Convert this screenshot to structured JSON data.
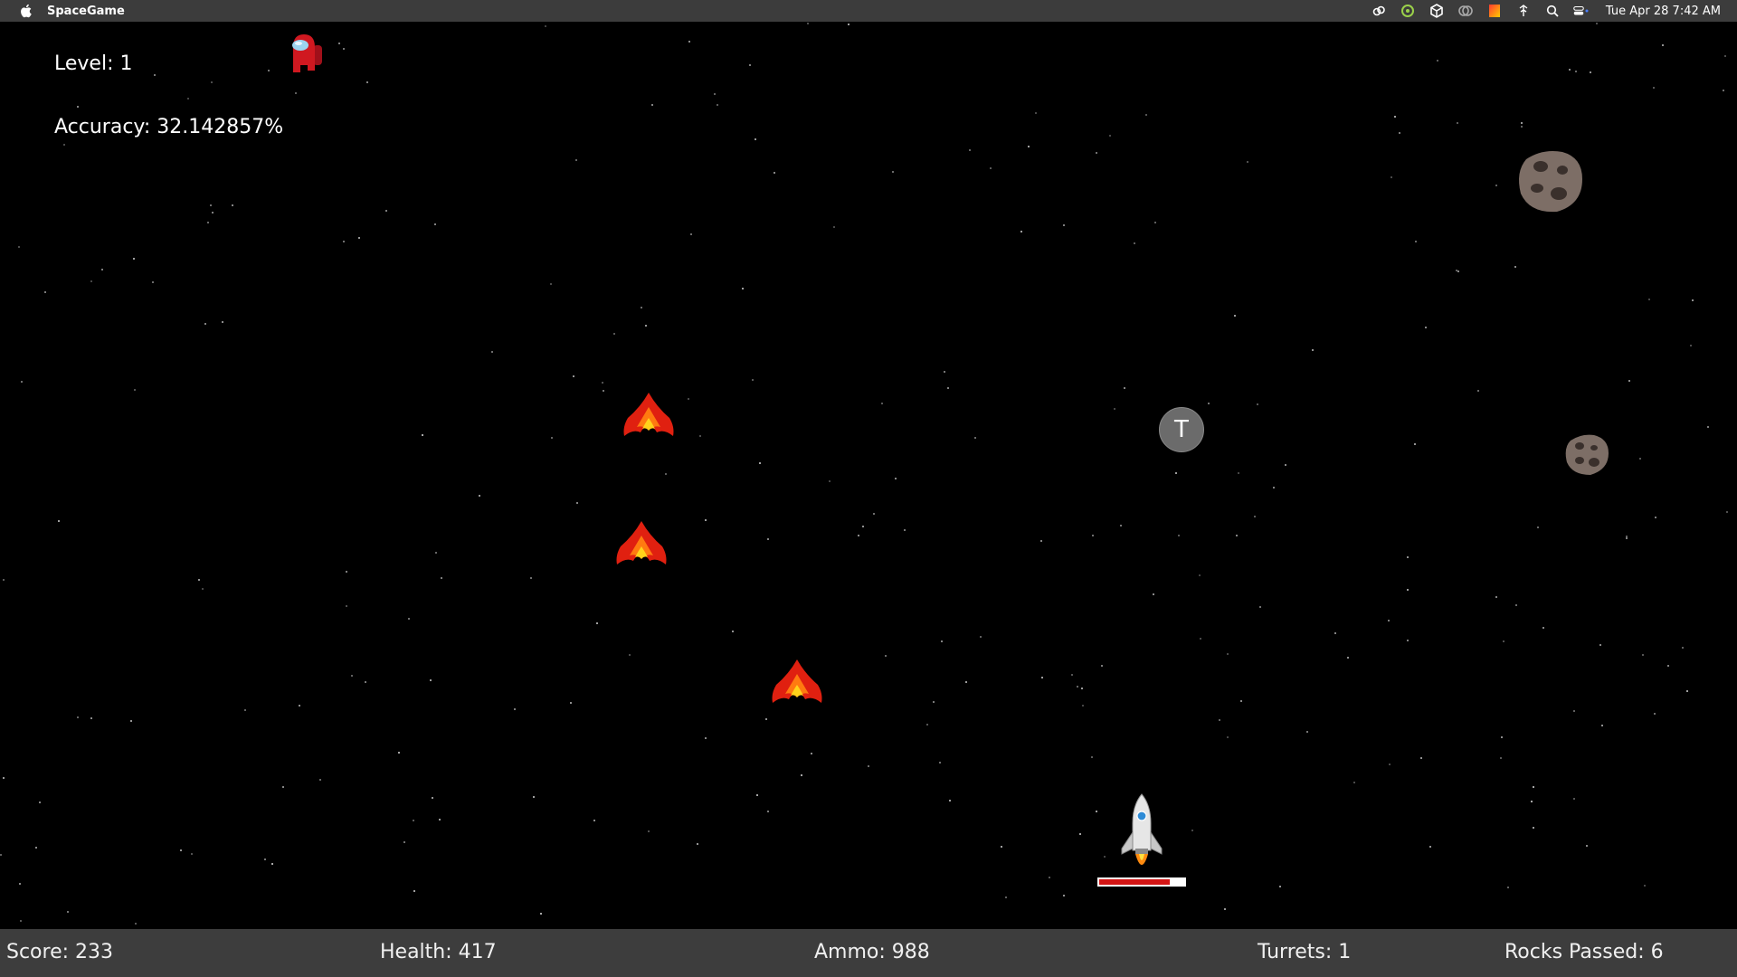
{
  "menubar": {
    "app_name": "SpaceGame",
    "clock": "Tue Apr 28  7:42 AM",
    "status_icons": [
      "creative-cloud-icon",
      "sync-icon",
      "unity-icon",
      "cc-icon",
      "color-icon",
      "network-icon",
      "search-icon",
      "control-center-icon"
    ]
  },
  "hud": {
    "level": "Level: 1",
    "accuracy": "Accuracy: 32.142857%"
  },
  "game": {
    "turret_token_label": "T",
    "player_health_fraction": 0.83,
    "sprites": [
      "red-crewmate-icon",
      "asteroid-icon",
      "fire-enemy-icon",
      "turret-powerup",
      "player-rocket-icon"
    ]
  },
  "statusbar": {
    "score": "Score: 233",
    "health": "Health: 417",
    "ammo": "Ammo: 988",
    "turrets": "Turrets: 1",
    "rocks_passed": "Rocks Passed: 6"
  },
  "colors": {
    "background": "#000000",
    "menubar": "#3c3c3c",
    "statusbar": "#3d3d3d",
    "health_fill": "#d41515",
    "enemy_fire": "#e02010"
  }
}
